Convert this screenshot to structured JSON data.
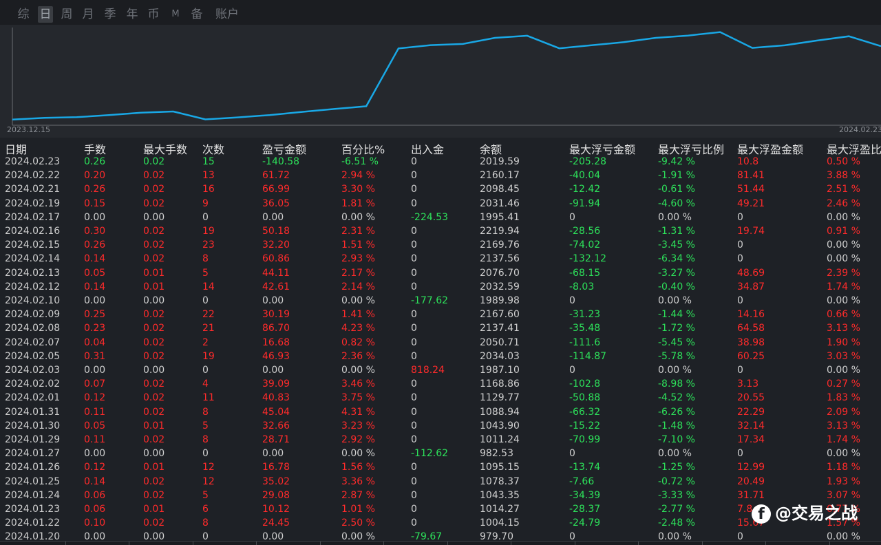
{
  "tabs": [
    "综",
    "日",
    "周",
    "月",
    "季",
    "年",
    "币",
    "M",
    "备",
    "账户"
  ],
  "active_tab": "日",
  "chart": {
    "start_label": "2023.12.15",
    "end_label": "2024.02.23",
    "line_color": "#19a8e6"
  },
  "table": {
    "headers": [
      "日期",
      "手数",
      "最大手数",
      "次数",
      "盈亏金额",
      "百分比%",
      "出入金",
      "余额",
      "最大浮亏金额",
      "最大浮亏比例",
      "最大浮盈金额",
      "最大浮盈比"
    ],
    "rows": [
      [
        "2024.02.23",
        "0.26",
        "0.02",
        "15",
        "-140.58",
        "-6.51 %",
        "0",
        "2019.59",
        "-205.28",
        "-9.42 %",
        "10.8",
        "0.50 %"
      ],
      [
        "2024.02.22",
        "0.20",
        "0.02",
        "13",
        "61.72",
        "2.94 %",
        "0",
        "2160.17",
        "-40.04",
        "-1.91 %",
        "81.41",
        "3.88 %"
      ],
      [
        "2024.02.21",
        "0.26",
        "0.02",
        "16",
        "66.99",
        "3.30 %",
        "0",
        "2098.45",
        "-12.42",
        "-0.61 %",
        "51.44",
        "2.51 %"
      ],
      [
        "2024.02.19",
        "0.15",
        "0.02",
        "9",
        "36.05",
        "1.81 %",
        "0",
        "2031.46",
        "-91.94",
        "-4.60 %",
        "49.21",
        "2.46 %"
      ],
      [
        "2024.02.17",
        "0.00",
        "0.00",
        "0",
        "0.00",
        "0.00 %",
        "-224.53",
        "1995.41",
        "0",
        "0.00 %",
        "0",
        "0.00 %"
      ],
      [
        "2024.02.16",
        "0.30",
        "0.02",
        "19",
        "50.18",
        "2.31 %",
        "0",
        "2219.94",
        "-28.56",
        "-1.31 %",
        "19.74",
        "0.91 %"
      ],
      [
        "2024.02.15",
        "0.26",
        "0.02",
        "23",
        "32.20",
        "1.51 %",
        "0",
        "2169.76",
        "-74.02",
        "-3.45 %",
        "0",
        "0.00 %"
      ],
      [
        "2024.02.14",
        "0.14",
        "0.02",
        "8",
        "60.86",
        "2.93 %",
        "0",
        "2137.56",
        "-132.12",
        "-6.34 %",
        "0",
        "0.00 %"
      ],
      [
        "2024.02.13",
        "0.05",
        "0.01",
        "5",
        "44.11",
        "2.17 %",
        "0",
        "2076.70",
        "-68.15",
        "-3.27 %",
        "48.69",
        "2.39 %"
      ],
      [
        "2024.02.12",
        "0.14",
        "0.01",
        "14",
        "42.61",
        "2.14 %",
        "0",
        "2032.59",
        "-8.03",
        "-0.40 %",
        "34.87",
        "1.74 %"
      ],
      [
        "2024.02.10",
        "0.00",
        "0.00",
        "0",
        "0.00",
        "0.00 %",
        "-177.62",
        "1989.98",
        "0",
        "0.00 %",
        "0",
        "0.00 %"
      ],
      [
        "2024.02.09",
        "0.25",
        "0.02",
        "22",
        "30.19",
        "1.41 %",
        "0",
        "2167.60",
        "-31.23",
        "-1.44 %",
        "14.16",
        "0.66 %"
      ],
      [
        "2024.02.08",
        "0.23",
        "0.02",
        "21",
        "86.70",
        "4.23 %",
        "0",
        "2137.41",
        "-35.48",
        "-1.72 %",
        "64.58",
        "3.13 %"
      ],
      [
        "2024.02.07",
        "0.04",
        "0.02",
        "2",
        "16.68",
        "0.82 %",
        "0",
        "2050.71",
        "-111.6",
        "-5.45 %",
        "38.98",
        "1.90 %"
      ],
      [
        "2024.02.05",
        "0.31",
        "0.02",
        "19",
        "46.93",
        "2.36 %",
        "0",
        "2034.03",
        "-114.87",
        "-5.78 %",
        "60.25",
        "3.03 %"
      ],
      [
        "2024.02.03",
        "0.00",
        "0.00",
        "0",
        "0.00",
        "0.00 %",
        "818.24",
        "1987.10",
        "0",
        "0.00 %",
        "0",
        "0.00 %"
      ],
      [
        "2024.02.02",
        "0.07",
        "0.02",
        "4",
        "39.09",
        "3.46 %",
        "0",
        "1168.86",
        "-102.8",
        "-8.98 %",
        "3.13",
        "0.27 %"
      ],
      [
        "2024.02.01",
        "0.12",
        "0.02",
        "11",
        "40.83",
        "3.75 %",
        "0",
        "1129.77",
        "-50.88",
        "-4.52 %",
        "20.55",
        "1.83 %"
      ],
      [
        "2024.01.31",
        "0.11",
        "0.02",
        "8",
        "45.04",
        "4.31 %",
        "0",
        "1088.94",
        "-66.32",
        "-6.26 %",
        "22.29",
        "2.09 %"
      ],
      [
        "2024.01.30",
        "0.05",
        "0.01",
        "5",
        "32.66",
        "3.23 %",
        "0",
        "1043.90",
        "-15.22",
        "-1.48 %",
        "32.14",
        "3.13 %"
      ],
      [
        "2024.01.29",
        "0.11",
        "0.02",
        "8",
        "28.71",
        "2.92 %",
        "0",
        "1011.24",
        "-70.99",
        "-7.10 %",
        "17.34",
        "1.74 %"
      ],
      [
        "2024.01.27",
        "0.00",
        "0.00",
        "0",
        "0.00",
        "0.00 %",
        "-112.62",
        "982.53",
        "0",
        "0.00 %",
        "0",
        "0.00 %"
      ],
      [
        "2024.01.26",
        "0.12",
        "0.01",
        "12",
        "16.78",
        "1.56 %",
        "0",
        "1095.15",
        "-13.74",
        "-1.25 %",
        "12.99",
        "1.18 %"
      ],
      [
        "2024.01.25",
        "0.14",
        "0.02",
        "12",
        "35.02",
        "3.36 %",
        "0",
        "1078.37",
        "-7.66",
        "-0.72 %",
        "20.49",
        "1.93 %"
      ],
      [
        "2024.01.24",
        "0.06",
        "0.02",
        "5",
        "29.08",
        "2.87 %",
        "0",
        "1043.35",
        "-34.39",
        "-3.33 %",
        "31.71",
        "3.07 %"
      ],
      [
        "2024.01.23",
        "0.06",
        "0.01",
        "6",
        "10.12",
        "1.01 %",
        "0",
        "1014.27",
        "-28.37",
        "-2.77 %",
        "7.8",
        "0.77 %"
      ],
      [
        "2024.01.22",
        "0.10",
        "0.02",
        "8",
        "24.45",
        "2.50 %",
        "0",
        "1004.15",
        "-24.79",
        "-2.48 %",
        "15.67",
        "1.57 %"
      ],
      [
        "2024.01.20",
        "0.00",
        "0.00",
        "0",
        "0.00",
        "0.00 %",
        "-79.67",
        "979.70",
        "0",
        "0.00 %",
        "0",
        "0.00 %"
      ]
    ]
  },
  "colors": {
    "positive": "#ff2b2b",
    "negative": "#2de05a",
    "neutral": "#cfcfcf"
  },
  "watermark": {
    "icon": "facebook-icon",
    "text": "@交易之战"
  }
}
